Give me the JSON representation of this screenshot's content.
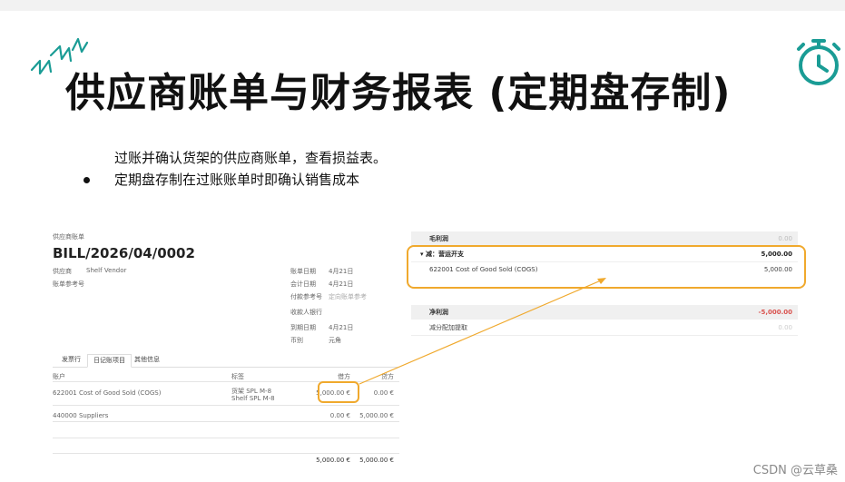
{
  "slide": {
    "title": "供应商账单与财务报表 (定期盘存制)",
    "bullets": [
      "过账并确认货架的供应商账单，查看损益表。",
      "定期盘存制在过账账单时即确认销售成本"
    ],
    "icons": {
      "decor": "sparkle-icon",
      "timer": "stopwatch-icon"
    },
    "accent_color": "#1a9c95",
    "highlight_color": "#f0a92d"
  },
  "bill": {
    "caption": "供应商账单",
    "number": "BILL/2026/04/0002",
    "vendor_label": "供应商",
    "vendor_value": "Shelf Vendor",
    "ref_label": "账单参考号",
    "fields": [
      {
        "label": "账单日期",
        "value": "4月21日"
      },
      {
        "label": "会计日期",
        "value": "4月21日"
      },
      {
        "label": "付款参考号",
        "value": "定向账单参考"
      },
      {
        "label": "收款人银行",
        "value": ""
      },
      {
        "label": "到期日期",
        "value": "4月21日"
      },
      {
        "label": "币别",
        "value": "元角"
      }
    ],
    "tabs": [
      "发票行",
      "日记账项目",
      "其他信息"
    ],
    "columns": [
      "账户",
      "标签",
      "借方",
      "贷方"
    ],
    "rows": [
      {
        "account": "622001 Cost of Good Sold (COGS)",
        "label1": "货架 SPL M-8",
        "label2": "Shelf SPL M-8",
        "debit": "5,000.00 €",
        "credit": "0.00 €"
      },
      {
        "account": "440000 Suppliers",
        "label1": "",
        "label2": "",
        "debit": "0.00 €",
        "credit": "5,000.00 €"
      }
    ],
    "totals": {
      "debit": "5,000.00 €",
      "credit": "5,000.00 €"
    }
  },
  "report": {
    "gross_profit": {
      "label": "毛利润",
      "value": "0.00"
    },
    "less_opex": {
      "label": "减：营运开支",
      "value": "5,000.00"
    },
    "cogs_line": {
      "label": "622001 Cost of Good Sold (COGS)",
      "value": "5,000.00"
    },
    "net_profit": {
      "label": "净利润",
      "value": "-5,000.00"
    },
    "depreciation": {
      "label": "减分配加提取",
      "value": "0.00"
    }
  },
  "watermark": "CSDN @云草桑"
}
